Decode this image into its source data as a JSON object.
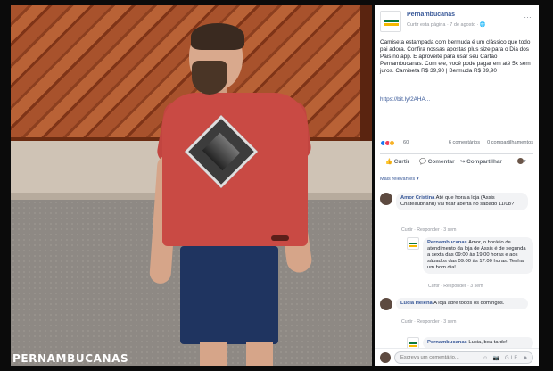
{
  "photo": {
    "watermark": "PERNAMBUCANAS"
  },
  "post": {
    "page_name": "Pernambucanas",
    "meta": "Curtir esta página · 7 de agosto · 🌐",
    "text": "Camiseta estampada com bermuda é um clássico que todo pai adora. Confira nossas apostas plus size para o Dia dos Pais no app. E aproveite para usar seu Cartão Pernambucanas. Com ele, você pode pagar em até 5x sem juros. Camiseta R$ 39,90 | Bermuda R$ 89,90",
    "link": "https://bit.ly/2AHA...",
    "more_icon": "…",
    "reaction_count": "60",
    "comment_count": "6 comentários",
    "share_count": "0 compartilhamentos"
  },
  "actions": {
    "like": "👍 Curtir",
    "comment": "💬 Comentar",
    "share": "↪ Compartilhar"
  },
  "comments_filter": "Mais relevantes ▾",
  "comments": [
    {
      "author": "Amor Cristina",
      "text": "Até que hora a loja (Assis Chateaubriand) vai ficar aberta no sábado 11/08?",
      "actions": "Curtir · Responder · 3 sem"
    },
    {
      "author": "Pernambucanas",
      "text": "Amor, o horário de atendimento da loja de Assis é de segunda a sexta das 09:00 às 19:00 horas e aos sábados das 09:00 às 17:00 horas. Tenha um bom dia!",
      "actions": "Curtir · Responder · 3 sem"
    },
    {
      "author": "Lucia Helena",
      "text": "A loja abre todos os domingos.",
      "actions": "Curtir · Responder · 3 sem"
    },
    {
      "author": "Pernambucanas",
      "text": "Lucia, boa tarde!",
      "actions": ""
    }
  ],
  "compose": {
    "placeholder": "Escreva um comentário...",
    "icons": "☺ 📷 GIF ☻"
  }
}
